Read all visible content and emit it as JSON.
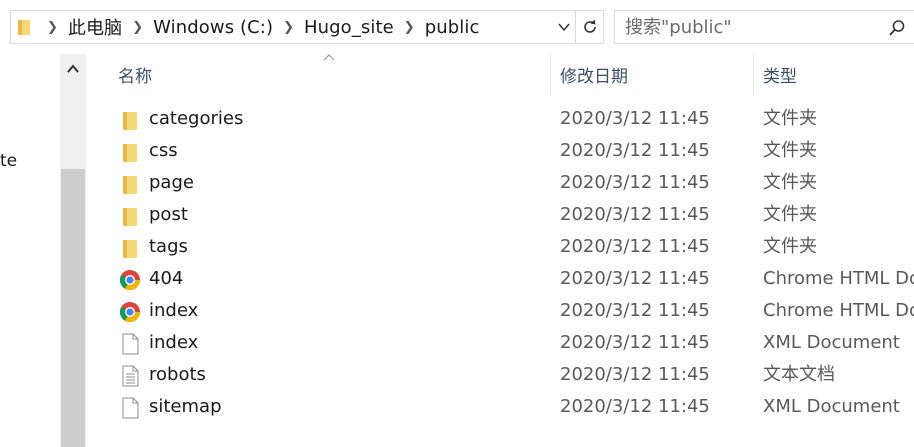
{
  "address": {
    "breadcrumbs": [
      "此电脑",
      "Windows (C:)",
      "Hugo_site",
      "public"
    ]
  },
  "search": {
    "placeholder": "搜索\"public\""
  },
  "nav_pane": {
    "visible_fragment": "te"
  },
  "columns": {
    "name": "名称",
    "date": "修改日期",
    "type": "类型"
  },
  "files": [
    {
      "name": "categories",
      "date": "2020/3/12 11:45",
      "type": "文件夹",
      "icon": "folder-icon"
    },
    {
      "name": "css",
      "date": "2020/3/12 11:45",
      "type": "文件夹",
      "icon": "folder-icon"
    },
    {
      "name": "page",
      "date": "2020/3/12 11:45",
      "type": "文件夹",
      "icon": "folder-icon"
    },
    {
      "name": "post",
      "date": "2020/3/12 11:45",
      "type": "文件夹",
      "icon": "folder-icon"
    },
    {
      "name": "tags",
      "date": "2020/3/12 11:45",
      "type": "文件夹",
      "icon": "folder-icon"
    },
    {
      "name": "404",
      "date": "2020/3/12 11:45",
      "type": "Chrome HTML Do",
      "icon": "chrome-icon"
    },
    {
      "name": "index",
      "date": "2020/3/12 11:45",
      "type": "Chrome HTML Do",
      "icon": "chrome-icon"
    },
    {
      "name": "index",
      "date": "2020/3/12 11:45",
      "type": "XML Document",
      "icon": "document-icon"
    },
    {
      "name": "robots",
      "date": "2020/3/12 11:45",
      "type": "文本文档",
      "icon": "text-document-icon"
    },
    {
      "name": "sitemap",
      "date": "2020/3/12 11:45",
      "type": "XML Document",
      "icon": "document-icon"
    }
  ],
  "colors": {
    "folder": "#f8d775",
    "folder_dark": "#e8b94a",
    "header_text": "#3b4f6b",
    "secondary_text": "#595959"
  }
}
